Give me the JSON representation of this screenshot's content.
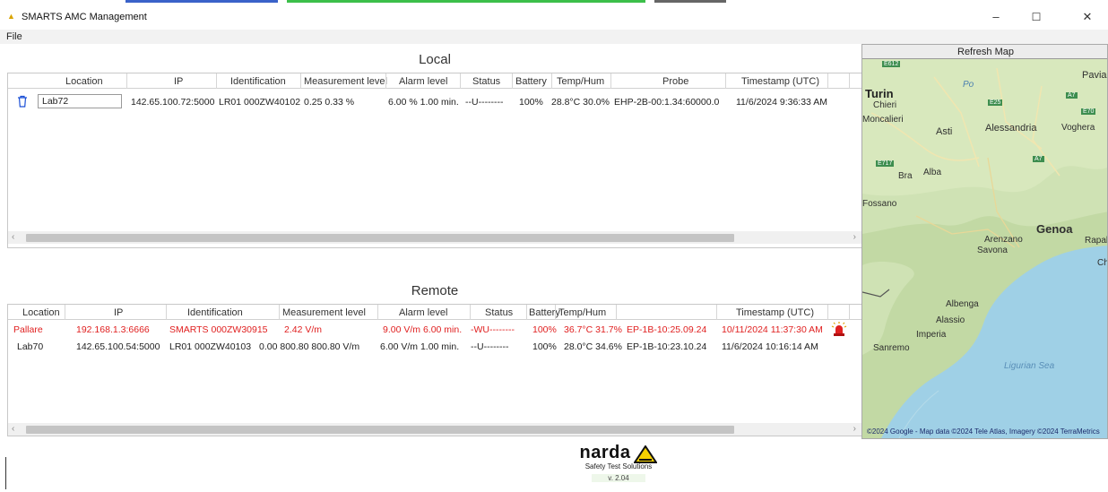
{
  "window": {
    "title": "SMARTS AMC Management",
    "minimize": "–",
    "maximize": "☐",
    "close": "✕"
  },
  "menu": {
    "file": "File"
  },
  "local": {
    "title": "Local",
    "columns": [
      "Location",
      "IP",
      "Identification",
      "Measurement level",
      "Alarm level",
      "Status",
      "Battery",
      "Temp/Hum",
      "Probe",
      "Timestamp (UTC)"
    ],
    "rows": [
      {
        "location": "Lab72",
        "ip": "142.65.100.72:5000",
        "identification": "LR01 000ZW40102",
        "measurement": "0.25 0.33  %",
        "alarm": "6.00 % 1.00 min.",
        "status": "--U--------",
        "battery": "100%",
        "temphum": "28.8°C 30.0%",
        "probe": "EHP-2B-00:1.34:60000.0",
        "timestamp": "11/6/2024 9:36:33 AM"
      }
    ]
  },
  "remote": {
    "title": "Remote",
    "columns": [
      "Location",
      "IP",
      "Identification",
      "Measurement level",
      "Alarm level",
      "Status",
      "Battery",
      "Temp/Hum",
      "Timestamp (UTC)"
    ],
    "rows": [
      {
        "location": "Pallare",
        "ip": "192.168.1.3:6666",
        "identification": "SMARTS 000ZW30915",
        "measurement": "2.42   V/m",
        "alarm": "9.00 V/m 6.00 min.",
        "status": "-WU--------",
        "battery": "100%",
        "temphum": "36.7°C 31.7%",
        "probe": "EP-1B-10:25.09.24",
        "timestamp": "10/11/2024 11:37:30 AM",
        "alarm_active": true
      },
      {
        "location": "Lab70",
        "ip": "142.65.100.54:5000",
        "identification": "LR01 000ZW40103",
        "measurement": "0.00 800.80 800.80  V/m",
        "alarm": "6.00 V/m 1.00 min.",
        "status": "--U--------",
        "battery": "100%",
        "temphum": "28.0°C 34.6%",
        "probe": "EP-1B-10:23.10.24",
        "timestamp": "11/6/2024 10:16:14 AM",
        "alarm_active": false
      }
    ]
  },
  "map": {
    "refresh_label": "Refresh Map",
    "places": [
      "Turin",
      "Chieri",
      "Moncalieri",
      "Asti",
      "Alessandria",
      "Voghera",
      "Pavia",
      "Po",
      "Bra",
      "Alba",
      "Fossano",
      "Genoa",
      "Arenzano",
      "Savona",
      "Rapal",
      "Chi",
      "Albenga",
      "Alassio",
      "Imperia",
      "Sanremo",
      "Ligurian Sea"
    ],
    "road_labels": [
      "E612",
      "E25",
      "E70",
      "A7",
      "A7",
      "E717"
    ],
    "copyright": "©2024 Google - Map data ©2024 Tele Atlas, Imagery ©2024 TerraMetrics"
  },
  "footer": {
    "brand": "narda",
    "tagline": "Safety Test Solutions",
    "version": "v. 2.04"
  },
  "colors": {
    "alarm_red": "#e02020",
    "accent_blue": "#1a4fd6",
    "sea": "#9fd0e6",
    "land": "#c9dfae"
  }
}
